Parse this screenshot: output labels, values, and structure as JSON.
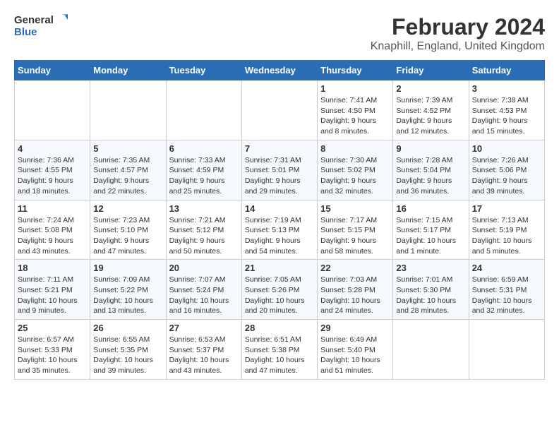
{
  "header": {
    "logo_general": "General",
    "logo_blue": "Blue",
    "main_title": "February 2024",
    "subtitle": "Knaphill, England, United Kingdom"
  },
  "calendar": {
    "weekdays": [
      "Sunday",
      "Monday",
      "Tuesday",
      "Wednesday",
      "Thursday",
      "Friday",
      "Saturday"
    ],
    "weeks": [
      [
        {
          "day": "",
          "info": ""
        },
        {
          "day": "",
          "info": ""
        },
        {
          "day": "",
          "info": ""
        },
        {
          "day": "",
          "info": ""
        },
        {
          "day": "1",
          "info": "Sunrise: 7:41 AM\nSunset: 4:50 PM\nDaylight: 9 hours\nand 8 minutes."
        },
        {
          "day": "2",
          "info": "Sunrise: 7:39 AM\nSunset: 4:52 PM\nDaylight: 9 hours\nand 12 minutes."
        },
        {
          "day": "3",
          "info": "Sunrise: 7:38 AM\nSunset: 4:53 PM\nDaylight: 9 hours\nand 15 minutes."
        }
      ],
      [
        {
          "day": "4",
          "info": "Sunrise: 7:36 AM\nSunset: 4:55 PM\nDaylight: 9 hours\nand 18 minutes."
        },
        {
          "day": "5",
          "info": "Sunrise: 7:35 AM\nSunset: 4:57 PM\nDaylight: 9 hours\nand 22 minutes."
        },
        {
          "day": "6",
          "info": "Sunrise: 7:33 AM\nSunset: 4:59 PM\nDaylight: 9 hours\nand 25 minutes."
        },
        {
          "day": "7",
          "info": "Sunrise: 7:31 AM\nSunset: 5:01 PM\nDaylight: 9 hours\nand 29 minutes."
        },
        {
          "day": "8",
          "info": "Sunrise: 7:30 AM\nSunset: 5:02 PM\nDaylight: 9 hours\nand 32 minutes."
        },
        {
          "day": "9",
          "info": "Sunrise: 7:28 AM\nSunset: 5:04 PM\nDaylight: 9 hours\nand 36 minutes."
        },
        {
          "day": "10",
          "info": "Sunrise: 7:26 AM\nSunset: 5:06 PM\nDaylight: 9 hours\nand 39 minutes."
        }
      ],
      [
        {
          "day": "11",
          "info": "Sunrise: 7:24 AM\nSunset: 5:08 PM\nDaylight: 9 hours\nand 43 minutes."
        },
        {
          "day": "12",
          "info": "Sunrise: 7:23 AM\nSunset: 5:10 PM\nDaylight: 9 hours\nand 47 minutes."
        },
        {
          "day": "13",
          "info": "Sunrise: 7:21 AM\nSunset: 5:12 PM\nDaylight: 9 hours\nand 50 minutes."
        },
        {
          "day": "14",
          "info": "Sunrise: 7:19 AM\nSunset: 5:13 PM\nDaylight: 9 hours\nand 54 minutes."
        },
        {
          "day": "15",
          "info": "Sunrise: 7:17 AM\nSunset: 5:15 PM\nDaylight: 9 hours\nand 58 minutes."
        },
        {
          "day": "16",
          "info": "Sunrise: 7:15 AM\nSunset: 5:17 PM\nDaylight: 10 hours\nand 1 minute."
        },
        {
          "day": "17",
          "info": "Sunrise: 7:13 AM\nSunset: 5:19 PM\nDaylight: 10 hours\nand 5 minutes."
        }
      ],
      [
        {
          "day": "18",
          "info": "Sunrise: 7:11 AM\nSunset: 5:21 PM\nDaylight: 10 hours\nand 9 minutes."
        },
        {
          "day": "19",
          "info": "Sunrise: 7:09 AM\nSunset: 5:22 PM\nDaylight: 10 hours\nand 13 minutes."
        },
        {
          "day": "20",
          "info": "Sunrise: 7:07 AM\nSunset: 5:24 PM\nDaylight: 10 hours\nand 16 minutes."
        },
        {
          "day": "21",
          "info": "Sunrise: 7:05 AM\nSunset: 5:26 PM\nDaylight: 10 hours\nand 20 minutes."
        },
        {
          "day": "22",
          "info": "Sunrise: 7:03 AM\nSunset: 5:28 PM\nDaylight: 10 hours\nand 24 minutes."
        },
        {
          "day": "23",
          "info": "Sunrise: 7:01 AM\nSunset: 5:30 PM\nDaylight: 10 hours\nand 28 minutes."
        },
        {
          "day": "24",
          "info": "Sunrise: 6:59 AM\nSunset: 5:31 PM\nDaylight: 10 hours\nand 32 minutes."
        }
      ],
      [
        {
          "day": "25",
          "info": "Sunrise: 6:57 AM\nSunset: 5:33 PM\nDaylight: 10 hours\nand 35 minutes."
        },
        {
          "day": "26",
          "info": "Sunrise: 6:55 AM\nSunset: 5:35 PM\nDaylight: 10 hours\nand 39 minutes."
        },
        {
          "day": "27",
          "info": "Sunrise: 6:53 AM\nSunset: 5:37 PM\nDaylight: 10 hours\nand 43 minutes."
        },
        {
          "day": "28",
          "info": "Sunrise: 6:51 AM\nSunset: 5:38 PM\nDaylight: 10 hours\nand 47 minutes."
        },
        {
          "day": "29",
          "info": "Sunrise: 6:49 AM\nSunset: 5:40 PM\nDaylight: 10 hours\nand 51 minutes."
        },
        {
          "day": "",
          "info": ""
        },
        {
          "day": "",
          "info": ""
        }
      ]
    ]
  }
}
